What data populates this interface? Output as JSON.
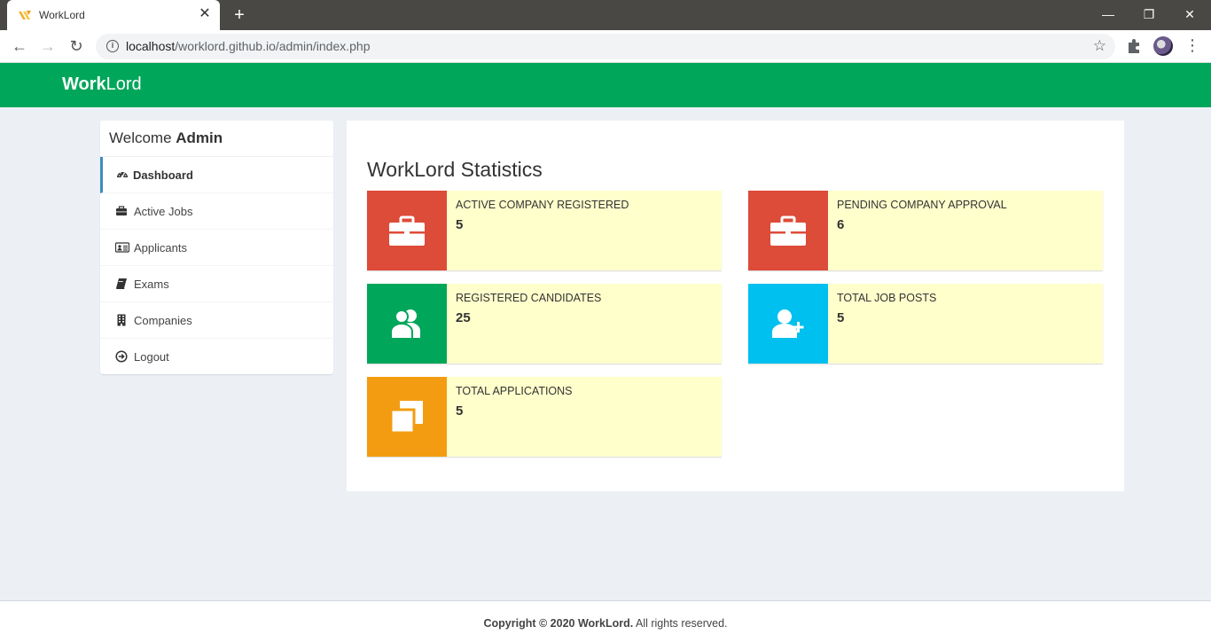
{
  "browser": {
    "tab_title": "WorkLord",
    "tab_close": "✕",
    "new_tab": "+",
    "url_host": "localhost",
    "url_path": "/worklord.github.io/admin/index.php",
    "minimize": "—",
    "restore": "❐",
    "close": "✕"
  },
  "header": {
    "logo_bold": "Work",
    "logo_regular": "Lord"
  },
  "sidebar": {
    "welcome_prefix": "Welcome ",
    "welcome_name": "Admin",
    "items": [
      {
        "label": "Dashboard",
        "icon": "dashboard-icon",
        "active": true
      },
      {
        "label": "Active Jobs",
        "icon": "briefcase-icon"
      },
      {
        "label": "Applicants",
        "icon": "address-card-icon"
      },
      {
        "label": "Exams",
        "icon": "book-icon"
      },
      {
        "label": "Companies",
        "icon": "building-icon"
      },
      {
        "label": "Logout",
        "icon": "logout-icon"
      }
    ]
  },
  "main": {
    "title": "WorkLord Statistics",
    "stats": [
      {
        "label": "ACTIVE COMPANY REGISTERED",
        "value": "5",
        "icon": "briefcase-icon",
        "color": "#dd4b39"
      },
      {
        "label": "PENDING COMPANY APPROVAL",
        "value": "6",
        "icon": "briefcase-icon",
        "color": "#dd4b39"
      },
      {
        "label": "REGISTERED CANDIDATES",
        "value": "25",
        "icon": "users-icon",
        "color": "#00a65a"
      },
      {
        "label": "TOTAL JOB POSTS",
        "value": "5",
        "icon": "user-plus-icon",
        "color": "#00c0ef"
      },
      {
        "label": "TOTAL APPLICATIONS",
        "value": "5",
        "icon": "clone-icon",
        "color": "#f39c12"
      }
    ]
  },
  "footer": {
    "copyright_bold": "Copyright © 2020 WorkLord.",
    "rights": " All rights reserved."
  },
  "colors": {
    "header_green": "#00a65a",
    "page_bg": "#ecf0f5",
    "info_box_bg": "#ffffcc",
    "active_border": "#3c8dbc"
  }
}
